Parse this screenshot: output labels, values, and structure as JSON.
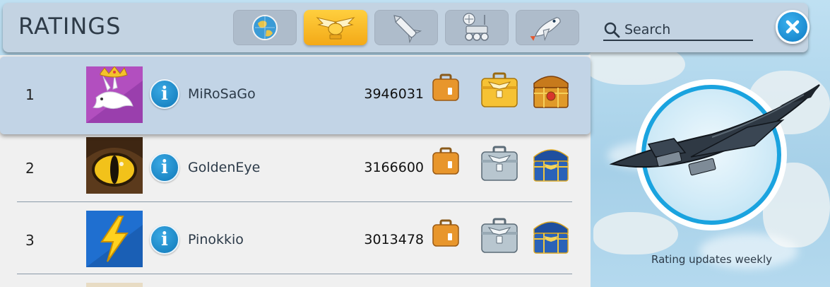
{
  "header": {
    "title": "RATINGS",
    "search_placeholder": "Search",
    "tabs": [
      {
        "name": "world",
        "icon": "globe-icon",
        "active": false
      },
      {
        "name": "emblem",
        "icon": "winged-emblem-icon",
        "active": true
      },
      {
        "name": "rocket",
        "icon": "rocket-icon",
        "active": false
      },
      {
        "name": "rover",
        "icon": "rover-icon",
        "active": false
      },
      {
        "name": "shuttle",
        "icon": "space-shuttle-icon",
        "active": false
      }
    ]
  },
  "ratings": [
    {
      "rank": "1",
      "player": "MiRoSaGo",
      "score": "3946031",
      "avatar": "crowned-rabbit-avatar",
      "reward_case": "gold-briefcase-icon",
      "reward_chest": "gold-chest-icon"
    },
    {
      "rank": "2",
      "player": "GoldenEye",
      "score": "3166600",
      "avatar": "golden-eye-avatar",
      "reward_case": "silver-briefcase-icon",
      "reward_chest": "blue-chest-icon"
    },
    {
      "rank": "3",
      "player": "Pinokkio",
      "score": "3013478",
      "avatar": "lightning-avatar",
      "reward_case": "silver-briefcase-icon",
      "reward_chest": "blue-chest-icon"
    }
  ],
  "side_panel": {
    "footer_note": "Rating updates weekly",
    "illustration": "supersonic-jet-icon"
  },
  "colors": {
    "accent_gold": "#f3a917",
    "accent_blue": "#1aa3df",
    "highlight_row": "#c2d4e6",
    "top_bar": "#c3d3e2"
  }
}
